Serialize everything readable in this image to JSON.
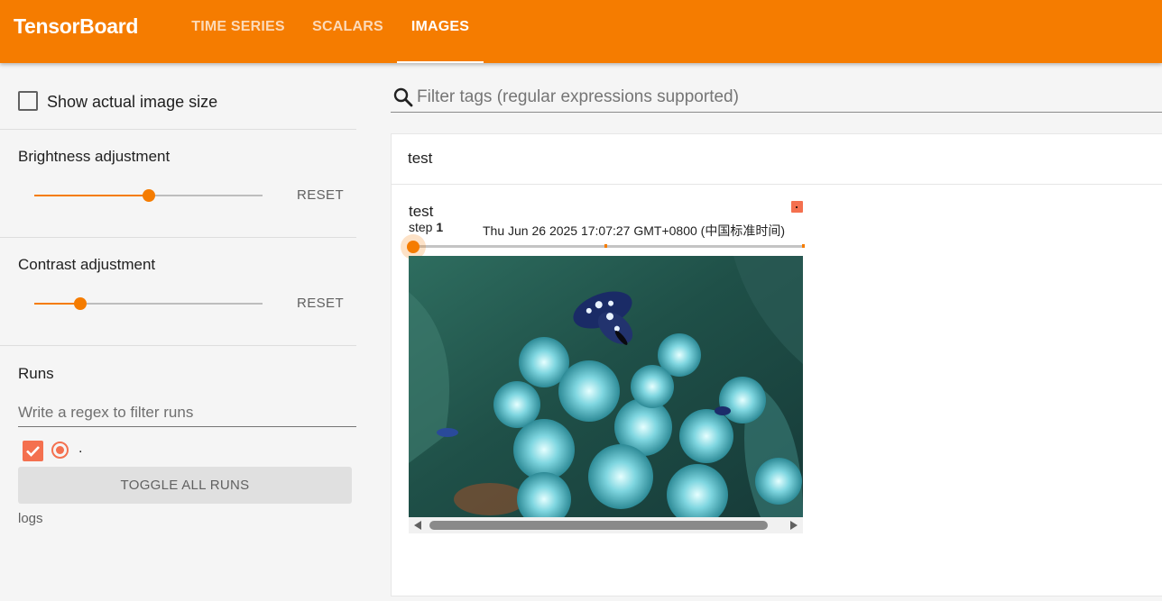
{
  "app": {
    "title": "TensorBoard",
    "accent_color": "#f57c00",
    "run_color": "#f4704f"
  },
  "nav": {
    "tabs": [
      {
        "label": "TIME SERIES",
        "active": false
      },
      {
        "label": "SCALARS",
        "active": false
      },
      {
        "label": "IMAGES",
        "active": true
      }
    ]
  },
  "sidebar": {
    "show_actual_size": {
      "label": "Show actual image size",
      "checked": false
    },
    "brightness": {
      "label": "Brightness adjustment",
      "value_fraction": 0.5,
      "reset_label": "RESET"
    },
    "contrast": {
      "label": "Contrast adjustment",
      "value_fraction": 0.2,
      "reset_label": "RESET"
    },
    "runs": {
      "title": "Runs",
      "filter_placeholder": "Write a regex to filter runs",
      "items": [
        {
          "name": ".",
          "checked": true,
          "selected": true
        }
      ],
      "toggle_label": "TOGGLE ALL RUNS",
      "logdir": "logs"
    }
  },
  "main": {
    "filter_placeholder": "Filter tags (regular expressions supported)",
    "tag_group": {
      "title": "test",
      "card": {
        "title": "test",
        "step_label": "step",
        "step_value": "1",
        "timestamp": "Thu Jun 26 2025 17:07:27 GMT+0800 (中国标准时间)",
        "image_icon": "butterfly-on-flowers-image"
      }
    }
  }
}
